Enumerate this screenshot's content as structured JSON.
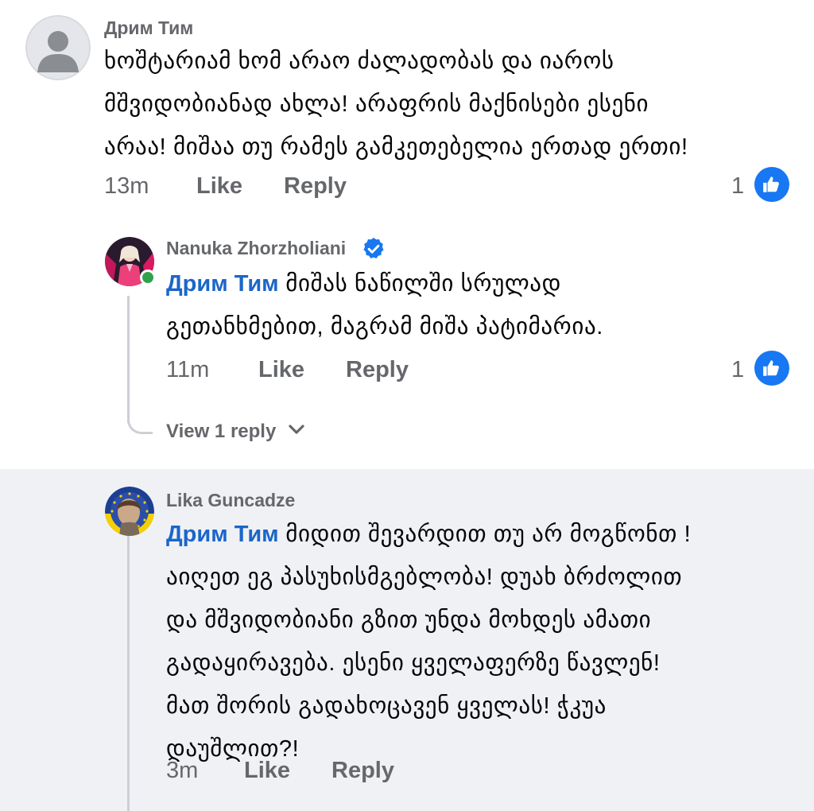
{
  "comments": [
    {
      "author": "Дрим Тим",
      "avatar": "default-avatar",
      "lines": [
        "ხოშტარიამ ხომ არაო ძალადობას და იაროს",
        "მშვიდობიანად ახლა! არაფრის მაქნისები ესენი",
        "არაა! მიშაა თუ რამეს გამკეთებელია ერთად ერთი!"
      ],
      "time": "13m",
      "like_label": "Like",
      "reply_label": "Reply",
      "reaction_count": "1",
      "reaction_icon": "like-thumb-icon"
    },
    {
      "author": "Nanuka Zhorzholiani",
      "verified": true,
      "online": true,
      "mention": "Дрим Тим",
      "line1_rest": "მიშას ნაწილში სრულად",
      "lines": [
        "გეთანხმებით, მაგრამ მიშა პატიმარია."
      ],
      "time": "11m",
      "like_label": "Like",
      "reply_label": "Reply",
      "reaction_count": "1",
      "reaction_icon": "like-thumb-icon",
      "view_replies": "View 1 reply"
    },
    {
      "author": "Lika Guncadze",
      "mention": "Дрим Тим",
      "line1_rest": "მიდით შევარდით თუ არ მოგწონთ !",
      "lines": [
        "აიღეთ ეგ პასუხისმგებლობა! დუახ ბრძოლით",
        "და მშვიდობიანი გზით უნდა მოხდეს ამათი",
        "გადაყირავება. ესენი ყველაფერზე წავლენ!",
        "მათ შორის გადახოცავენ ყველას! ჭკუა",
        "დაუშლით?!"
      ],
      "time": "3m",
      "like_label": "Like",
      "reply_label": "Reply"
    }
  ],
  "colors": {
    "mention": "#1b66c9",
    "meta": "#65676b",
    "like_badge": "#1877f2",
    "highlight_bg": "#eff1f5",
    "thread_line": "#ccd0d5"
  }
}
